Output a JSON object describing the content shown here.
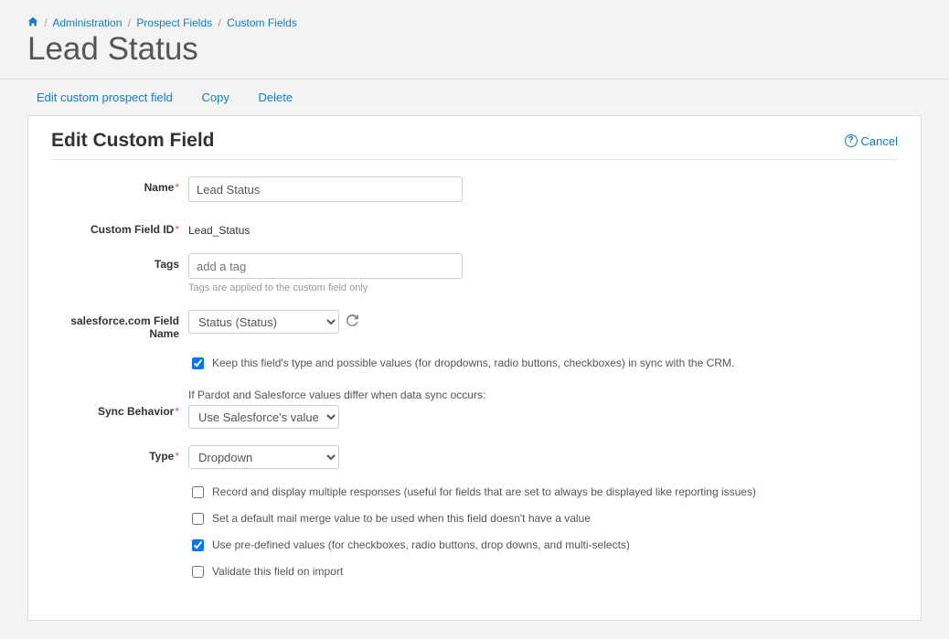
{
  "breadcrumb": {
    "items": [
      "Administration",
      "Prospect Fields",
      "Custom Fields"
    ]
  },
  "page_title": "Lead Status",
  "toolbar": {
    "edit_link": "Edit custom prospect field",
    "copy_link": "Copy",
    "delete_link": "Delete"
  },
  "panel": {
    "title": "Edit Custom Field",
    "cancel_label": "Cancel"
  },
  "form": {
    "name": {
      "label": "Name",
      "value": "Lead Status"
    },
    "custom_id": {
      "label": "Custom Field ID",
      "value": "Lead_Status"
    },
    "tags": {
      "label": "Tags",
      "placeholder": "add a tag",
      "help": "Tags are applied to the custom field only"
    },
    "sf_field": {
      "label": "salesforce.com Field Name",
      "selected": "Status (Status)"
    },
    "keep_sync": {
      "checked": true,
      "label": "Keep this field's type and possible values (for dropdowns, radio buttons, checkboxes) in sync with the CRM."
    },
    "sync_behavior": {
      "label": "Sync Behavior",
      "note": "If Pardot and Salesforce values differ when data sync occurs:",
      "selected": "Use Salesforce's value"
    },
    "type": {
      "label": "Type",
      "selected": "Dropdown"
    },
    "options": {
      "record_multiple": {
        "checked": false,
        "label": "Record and display multiple responses (useful for fields that are set to always be displayed like reporting issues)"
      },
      "set_default": {
        "checked": false,
        "label": "Set a default mail merge value to be used when this field doesn't have a value"
      },
      "predefined": {
        "checked": true,
        "label": "Use pre-defined values (for checkboxes, radio buttons, drop downs, and multi-selects)"
      },
      "validate": {
        "checked": false,
        "label": "Validate this field on import"
      }
    }
  }
}
